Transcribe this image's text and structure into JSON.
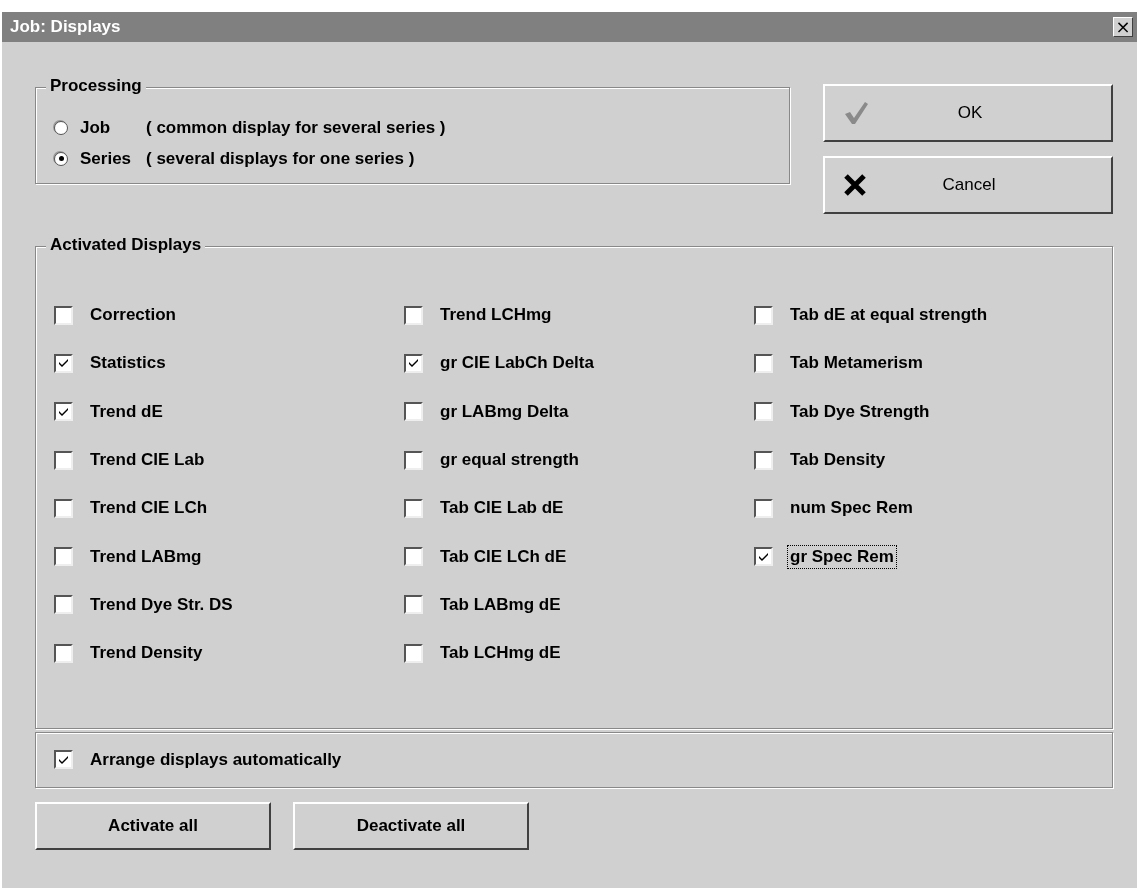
{
  "window": {
    "title": "Job: Displays",
    "close_glyph": "×"
  },
  "processing": {
    "title": "Processing",
    "options": [
      {
        "label": "Job",
        "note": "( common display for several series )",
        "selected": false
      },
      {
        "label": "Series",
        "note": "( several displays for one series )",
        "selected": true
      }
    ]
  },
  "buttons": [
    {
      "kind": "ok",
      "label": "OK"
    },
    {
      "kind": "cancel",
      "label": "Cancel"
    }
  ],
  "activated_displays": {
    "title": "Activated Displays",
    "columns": [
      [
        {
          "label": "Correction",
          "checked": false
        },
        {
          "label": "Statistics",
          "checked": true
        },
        {
          "label": "Trend dE",
          "checked": true
        },
        {
          "label": "Trend CIE Lab",
          "checked": false
        },
        {
          "label": "Trend CIE LCh",
          "checked": false
        },
        {
          "label": "Trend LABmg",
          "checked": false
        },
        {
          "label": "Trend Dye Str. DS",
          "checked": false
        },
        {
          "label": "Trend Density",
          "checked": false
        }
      ],
      [
        {
          "label": "Trend LCHmg",
          "checked": false
        },
        {
          "label": "gr CIE LabCh Delta",
          "checked": true
        },
        {
          "label": "gr LABmg Delta",
          "checked": false
        },
        {
          "label": "gr equal strength",
          "checked": false
        },
        {
          "label": "Tab CIE Lab dE",
          "checked": false
        },
        {
          "label": "Tab CIE LCh dE",
          "checked": false
        },
        {
          "label": "Tab LABmg dE",
          "checked": false
        },
        {
          "label": "Tab LCHmg dE",
          "checked": false
        }
      ],
      [
        {
          "label": "Tab dE at equal strength",
          "checked": false
        },
        {
          "label": "Tab Metamerism",
          "checked": false
        },
        {
          "label": "Tab Dye Strength",
          "checked": false
        },
        {
          "label": "Tab Density",
          "checked": false
        },
        {
          "label": "num Spec Rem",
          "checked": false
        },
        {
          "label": "gr Spec Rem",
          "checked": true,
          "focused": true
        }
      ]
    ]
  },
  "arrange": {
    "label": "Arrange displays automatically",
    "checked": true
  },
  "bottom_buttons": [
    {
      "label": "Activate all"
    },
    {
      "label": "Deactivate all"
    }
  ]
}
